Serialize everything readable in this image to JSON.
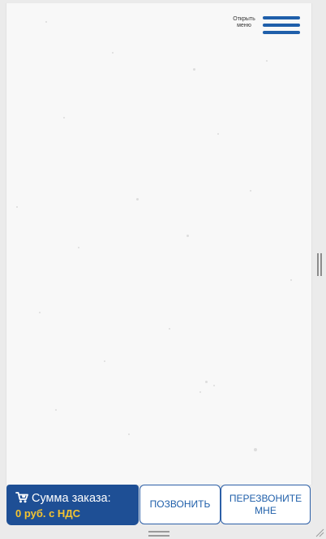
{
  "header": {
    "menu_label": "Открыть меню",
    "menu_icon": "hamburger-icon",
    "accent_color": "#1f5faa"
  },
  "bottom_bar": {
    "order_sum": {
      "label": "Сумма заказа:",
      "value": "0 руб. с НДС",
      "icon": "cart-icon",
      "background": "#1e4f95",
      "value_color": "#f4c430"
    },
    "call_button": "ПОЗВОНИТЬ",
    "callback_button": "ПЕРЕЗВОНИТЕ МНЕ"
  }
}
